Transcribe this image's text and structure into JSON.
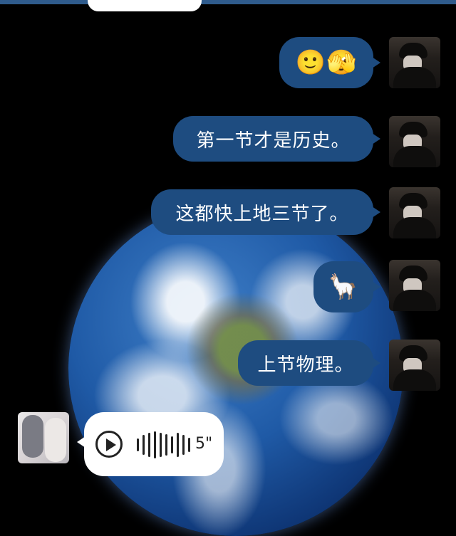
{
  "messages_right": [
    {
      "type": "emoji",
      "text": "🙂🫣"
    },
    {
      "type": "text",
      "text": "第一节才是历史。"
    },
    {
      "type": "text",
      "text": "这都快上地三节了。"
    },
    {
      "type": "emoji",
      "text": "🦙"
    },
    {
      "type": "text",
      "text": "上节物理。"
    }
  ],
  "voice_message": {
    "duration": "5\""
  },
  "icons": [
    "play-icon",
    "waveform-icon",
    "avatar-self",
    "avatar-other"
  ],
  "colors": {
    "bubble_sent": "#1e4c80",
    "bubble_received": "#ffffff",
    "background": "#000000"
  }
}
